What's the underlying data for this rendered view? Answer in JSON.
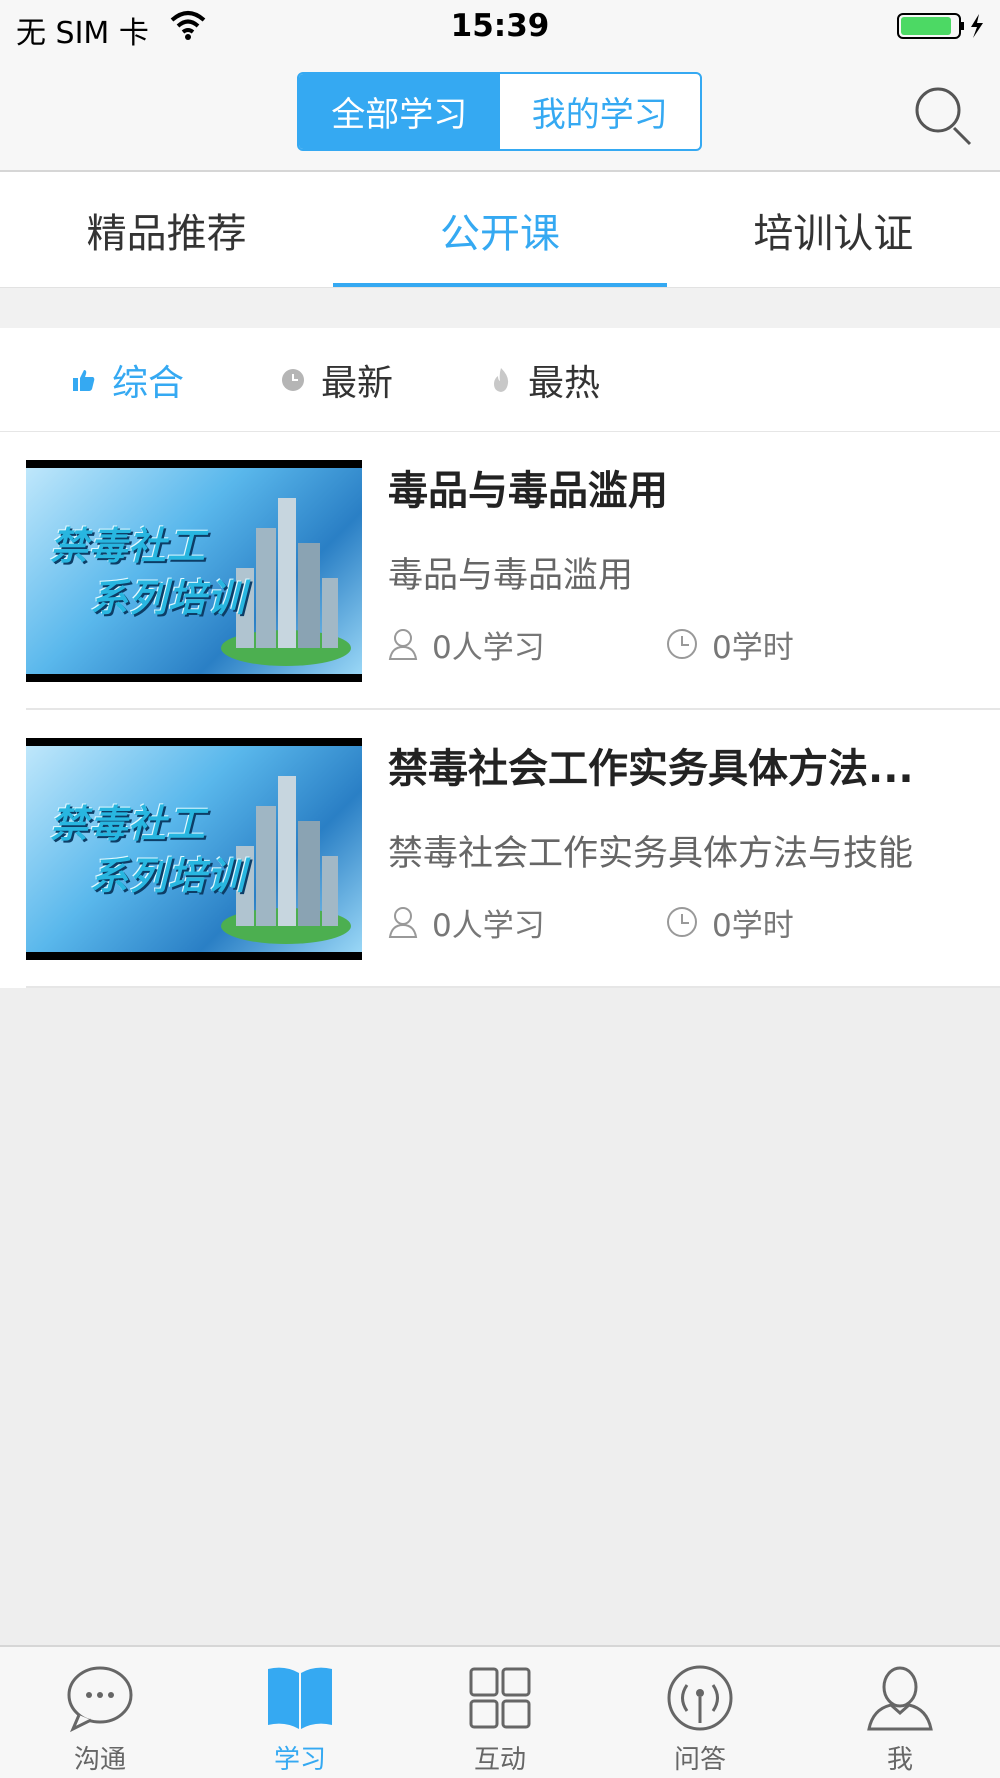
{
  "status_bar": {
    "carrier": "无 SIM 卡",
    "time": "15:39"
  },
  "header": {
    "segments": [
      {
        "label": "全部学习",
        "active": true
      },
      {
        "label": "我的学习",
        "active": false
      }
    ],
    "search_icon": "search-icon"
  },
  "tabs": [
    {
      "label": "精品推荐",
      "active": false
    },
    {
      "label": "公开课",
      "active": true
    },
    {
      "label": "培训认证",
      "active": false
    }
  ],
  "sort": [
    {
      "label": "综合",
      "icon": "thumbs-up-icon",
      "active": true
    },
    {
      "label": "最新",
      "icon": "clock-icon",
      "active": false
    },
    {
      "label": "最热",
      "icon": "flame-icon",
      "active": false
    }
  ],
  "courses": [
    {
      "thumb_text": [
        "禁毒社工",
        "系列培训"
      ],
      "title": "毒品与毒品滥用",
      "desc": "毒品与毒品滥用",
      "learners": "0人学习",
      "hours": "0学时"
    },
    {
      "thumb_text": [
        "禁毒社工",
        "系列培训"
      ],
      "title": "禁毒社会工作实务具体方法...",
      "desc": "禁毒社会工作实务具体方法与技能",
      "learners": "0人学习",
      "hours": "0学时"
    }
  ],
  "tab_bar": [
    {
      "label": "沟通",
      "icon": "chat-icon",
      "active": false
    },
    {
      "label": "学习",
      "icon": "book-icon",
      "active": true
    },
    {
      "label": "互动",
      "icon": "grid-icon",
      "active": false
    },
    {
      "label": "问答",
      "icon": "broadcast-icon",
      "active": false
    },
    {
      "label": "我",
      "icon": "person-icon",
      "active": false
    }
  ],
  "colors": {
    "accent": "#35a9f2",
    "background": "#eeeeee",
    "text": "#333333"
  }
}
